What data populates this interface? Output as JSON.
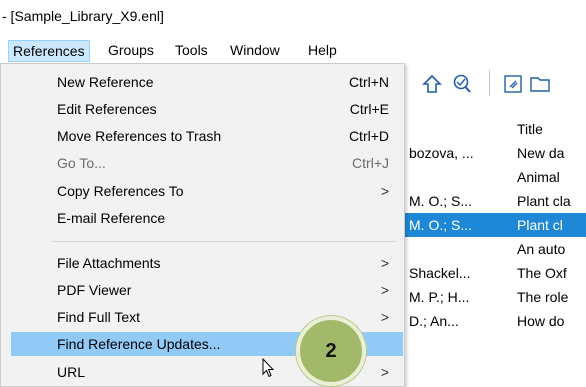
{
  "window": {
    "title": "- [Sample_Library_X9.enl]"
  },
  "menubar": {
    "items": [
      {
        "label": "References",
        "active": true
      },
      {
        "label": "Groups"
      },
      {
        "label": "Tools"
      },
      {
        "label": "Window"
      },
      {
        "label": "Help"
      }
    ]
  },
  "menu": {
    "items": [
      {
        "label": "New Reference",
        "accel": "Ctrl+N"
      },
      {
        "label": "Edit References",
        "accel": "Ctrl+E"
      },
      {
        "label": "Move References to Trash",
        "accel": "Ctrl+D"
      },
      {
        "label": "Go To...",
        "accel": "Ctrl+J",
        "disabled": true
      },
      {
        "label": "Copy References To",
        "submenu": true
      },
      {
        "label": "E-mail Reference"
      },
      {
        "label": "File Attachments",
        "submenu": true
      },
      {
        "label": "PDF Viewer",
        "submenu": true
      },
      {
        "label": "Find Full Text",
        "submenu": true
      },
      {
        "label": "Find Reference Updates...",
        "highlighted": true
      },
      {
        "label": "URL",
        "submenu": true
      }
    ],
    "submenu_arrow": ">"
  },
  "background": {
    "header": {
      "title_col": "Title"
    },
    "rows": [
      {
        "author": "bozova, ...",
        "title": "New da"
      },
      {
        "author": "",
        "title": "Animal"
      },
      {
        "author": "M. O.; S...",
        "title": "Plant cla"
      },
      {
        "author": "M. O.; S...",
        "title": "Plant cl",
        "selected": true
      },
      {
        "author": "",
        "title": "An auto"
      },
      {
        "author": "Shackel...",
        "title": "The Oxf"
      },
      {
        "author": "M. P.; H...",
        "title": "The role"
      },
      {
        "author": "D.; An...",
        "title": "How do"
      }
    ]
  },
  "annotation": {
    "step_number": "2",
    "color": "#a3b96a"
  }
}
